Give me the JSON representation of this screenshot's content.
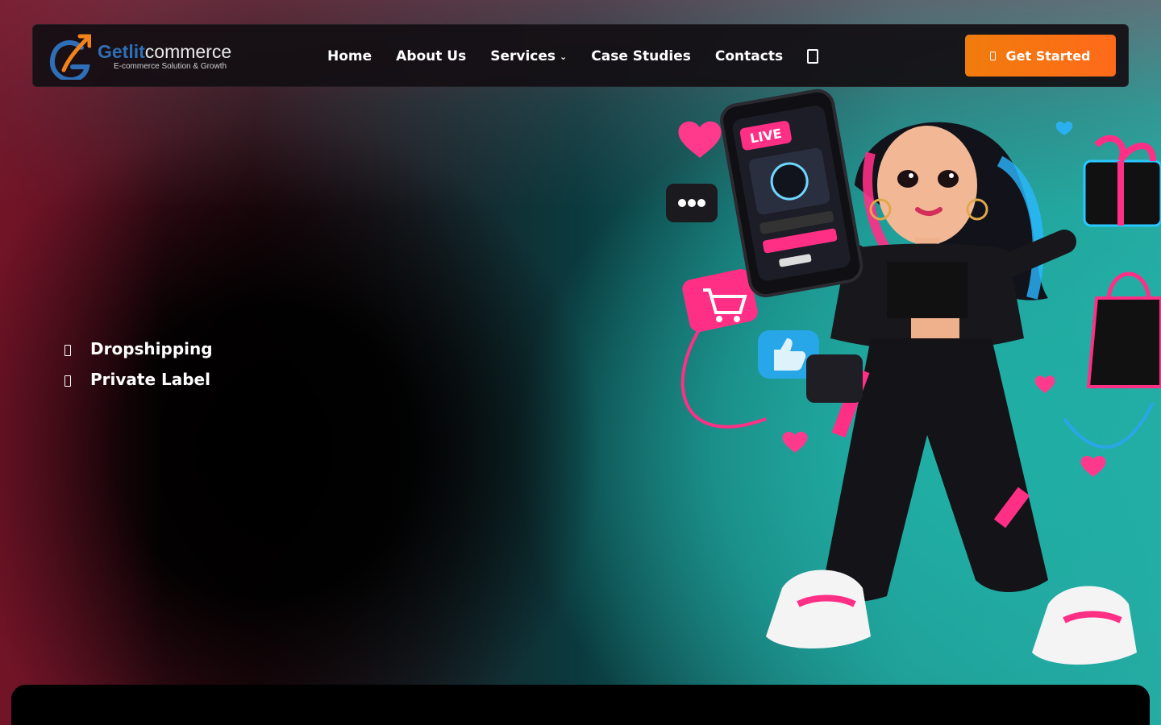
{
  "brand": {
    "name_part1": "Getlit",
    "name_part2": "commerce",
    "tagline": "E-commerce Solution & Growth"
  },
  "nav": {
    "links": [
      {
        "label": "Home"
      },
      {
        "label": "About Us"
      },
      {
        "label": "Services",
        "has_dropdown": true
      },
      {
        "label": "Case Studies"
      },
      {
        "label": "Contacts"
      }
    ],
    "search_icon": "search-icon",
    "cta_label": "Get Started",
    "cta_icon": "arrow-icon"
  },
  "hero": {
    "features": [
      {
        "label": "Dropshipping",
        "icon": "bullet-icon"
      },
      {
        "label": "Private Label",
        "icon": "bullet-icon"
      }
    ],
    "illustration": {
      "phone_badge": "LIVE"
    }
  },
  "colors": {
    "accent_orange": "#f07c0c",
    "brand_blue": "#2f6fb8",
    "teal": "#20b0a6",
    "pink": "#ff2f86"
  }
}
